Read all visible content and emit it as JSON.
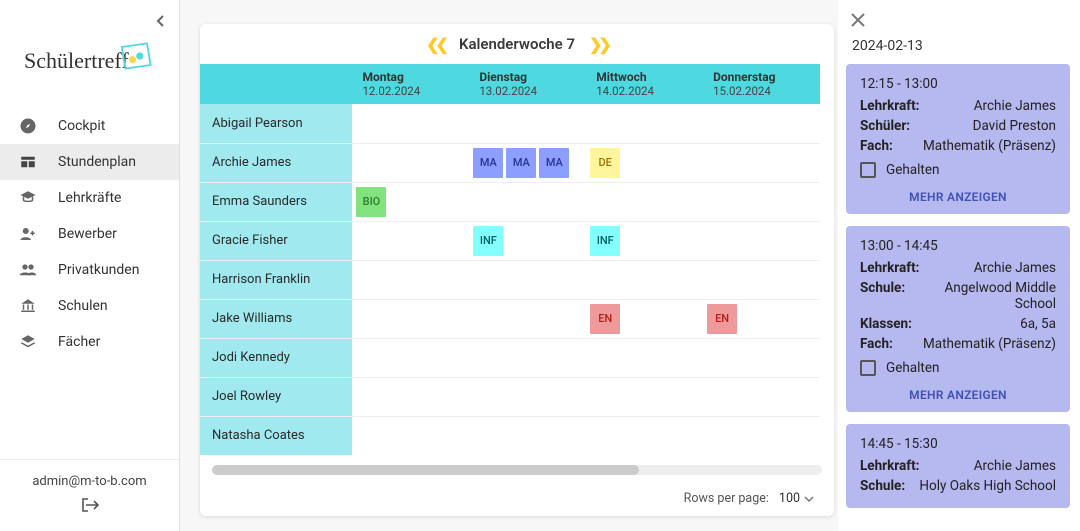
{
  "brand": "Schülertreff",
  "sidebar": {
    "items": [
      {
        "label": "Cockpit",
        "icon": "compass-icon"
      },
      {
        "label": "Stundenplan",
        "icon": "table-icon"
      },
      {
        "label": "Lehrkräfte",
        "icon": "grad-cap-icon"
      },
      {
        "label": "Bewerber",
        "icon": "person-add-icon"
      },
      {
        "label": "Privatkunden",
        "icon": "people-icon"
      },
      {
        "label": "Schulen",
        "icon": "bank-icon"
      },
      {
        "label": "Fächer",
        "icon": "layers-icon"
      }
    ],
    "user_email": "admin@m-to-b.com"
  },
  "week": {
    "title": "Kalenderwoche 7",
    "days": [
      {
        "name": "Montag",
        "date": "12.02.2024"
      },
      {
        "name": "Dienstag",
        "date": "13.02.2024"
      },
      {
        "name": "Mittwoch",
        "date": "14.02.2024"
      },
      {
        "name": "Donnerstag",
        "date": "15.02.2024"
      }
    ]
  },
  "rows": [
    {
      "name": "Abigail Pearson",
      "cells": [
        [],
        [],
        [],
        []
      ]
    },
    {
      "name": "Archie James",
      "cells": [
        [],
        [
          "MA",
          "MA",
          "MA"
        ],
        [
          "DE"
        ],
        []
      ]
    },
    {
      "name": "Emma Saunders",
      "cells": [
        [
          "BIO"
        ],
        [],
        [],
        []
      ]
    },
    {
      "name": "Gracie Fisher",
      "cells": [
        [],
        [
          "INF"
        ],
        [
          "INF"
        ],
        []
      ]
    },
    {
      "name": "Harrison Franklin",
      "cells": [
        [],
        [],
        [],
        []
      ]
    },
    {
      "name": "Jake Williams",
      "cells": [
        [],
        [],
        [
          "EN"
        ],
        [
          "EN"
        ]
      ]
    },
    {
      "name": "Jodi Kennedy",
      "cells": [
        [],
        [],
        [],
        []
      ]
    },
    {
      "name": "Joel Rowley",
      "cells": [
        [],
        [],
        [],
        []
      ]
    },
    {
      "name": "Natasha Coates",
      "cells": [
        [],
        [],
        [],
        []
      ]
    }
  ],
  "pager": {
    "label": "Rows per page:",
    "value": "100"
  },
  "detail": {
    "date": "2024-02-13",
    "events": [
      {
        "time": "12:15 - 13:00",
        "rows": [
          {
            "k": "Lehrkraft:",
            "v": "Archie James"
          },
          {
            "k": "Schüler:",
            "v": "David Preston"
          },
          {
            "k": "Fach:",
            "v": "Mathematik (Präsenz)"
          }
        ],
        "check_label": "Gehalten",
        "more": "MEHR ANZEIGEN"
      },
      {
        "time": "13:00 - 14:45",
        "rows": [
          {
            "k": "Lehrkraft:",
            "v": "Archie James"
          },
          {
            "k": "Schule:",
            "v": "Angelwood Middle School"
          },
          {
            "k": "Klassen:",
            "v": "6a, 5a"
          },
          {
            "k": "Fach:",
            "v": "Mathematik (Präsenz)"
          }
        ],
        "check_label": "Gehalten",
        "more": "MEHR ANZEIGEN"
      },
      {
        "time": "14:45 - 15:30",
        "rows": [
          {
            "k": "Lehrkraft:",
            "v": "Archie James"
          },
          {
            "k": "Schule:",
            "v": "Holy Oaks High School"
          }
        ]
      }
    ]
  }
}
